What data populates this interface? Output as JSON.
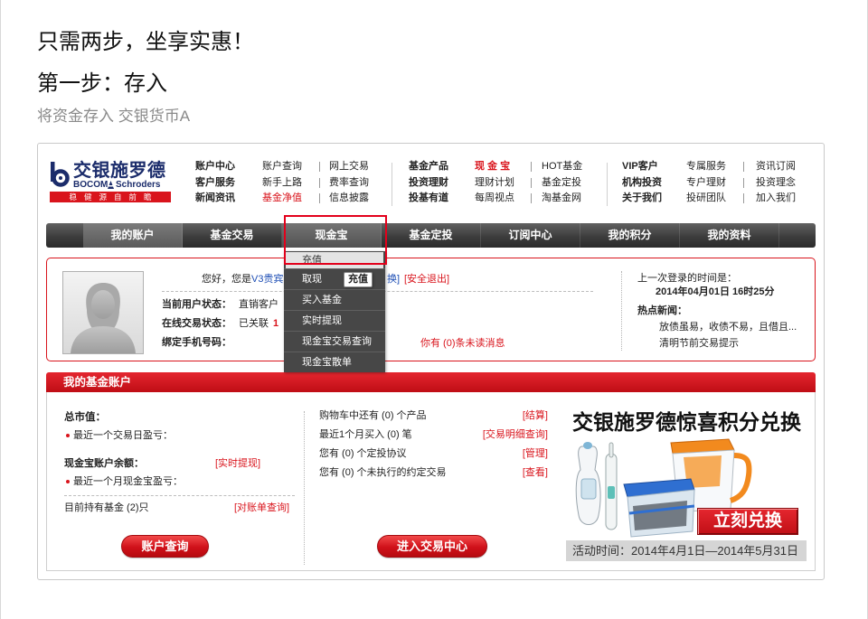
{
  "theme": {
    "brand_red": "#d9141c",
    "navy": "#1b2c6b",
    "link_blue": "#1f4fb5",
    "nav_dark": "#3a3a3a"
  },
  "icons": {
    "logo": "bocom-logo-icon",
    "schroders": "schroders-mark-icon",
    "avatar": "user-silhouette-icon"
  },
  "intro": {
    "headline": "只需两步，坐享实惠！",
    "step": "第一步：存入",
    "desc": "将资金存入 交银货币A"
  },
  "logo": {
    "cn": "交银施罗德",
    "en_a": "BOCOM",
    "en_b": "Schroders",
    "slogan": "稳健源自前瞻"
  },
  "top_links": {
    "col1": [
      "账户中心",
      "客户服务",
      "新闻资讯"
    ],
    "col2": [
      "账户查询",
      "新手上路",
      "基金净值"
    ],
    "col3": [
      "网上交易",
      "费率查询",
      "信息披露"
    ],
    "col4": [
      "基金产品",
      "投资理财",
      "投基有道"
    ],
    "col5": [
      "现 金 宝",
      "理财计划",
      "每周视点"
    ],
    "col6": [
      "HOT基金",
      "基金定投",
      "淘基金网"
    ],
    "col7": [
      "VIP客户",
      "机构投资",
      "关于我们"
    ],
    "col8": [
      "专属服务",
      "专户理财",
      "投研团队"
    ],
    "col9": [
      "资讯订阅",
      "投资理念",
      "加入我们"
    ]
  },
  "nav": {
    "items": [
      "我的账户",
      "基金交易",
      "现金宝",
      "基金定投",
      "订阅中心",
      "我的积分",
      "我的资料"
    ]
  },
  "dropdown": {
    "items": [
      "充值",
      "取现",
      "买入基金",
      "实时提现",
      "现金宝交易查询",
      "现金宝散单"
    ],
    "tooltip": "充值"
  },
  "account": {
    "greeting_prefix": "您好，您是",
    "greeting_level": "V3贵宾",
    "switch_tail": "换]",
    "logout": "[安全退出]",
    "status": [
      {
        "label": "当前用户状态：",
        "value": "直销客户"
      },
      {
        "label": "在线交易状态：",
        "value": "已关联",
        "extra": "1"
      },
      {
        "label": "绑定手机号码：",
        "value": ""
      }
    ],
    "messages": "你有 (0)条未读消息",
    "last_login_label": "上一次登录的时间是：",
    "last_login_time": "2014年04月01日 16时25分",
    "news_label": "热点新闻：",
    "news": [
      "放债虽易，收债不易，且借且...",
      "清明节前交易提示"
    ]
  },
  "fund_account": {
    "title": "我的基金账户",
    "total_label": "总市值：",
    "last_day_pl": "最近一个交易日盈亏：",
    "cash_balance_label": "现金宝账户余额：",
    "cash_withdraw_link": "[实时提现]",
    "cash_month_pl": "最近一个月现金宝盈亏：",
    "holding": "目前持有基金 (2)只",
    "statement_link": "[对账单查询]",
    "query_button": "账户查询",
    "rows": [
      {
        "text": "购物车中还有 (0) 个产品",
        "link": "[结算]"
      },
      {
        "text": "最近1个月买入 (0) 笔",
        "link": "[交易明细查询]"
      },
      {
        "text": "您有 (0) 个定投协议",
        "link": "[管理]"
      },
      {
        "text": "您有 (0) 个未执行的约定交易",
        "link": "[查看]"
      }
    ],
    "trade_button": "进入交易中心"
  },
  "promo": {
    "title": "交银施罗德惊喜积分兑换",
    "cta": "立刻兑换",
    "period": "活动时间：2014年4月1日—2014年5月31日"
  }
}
